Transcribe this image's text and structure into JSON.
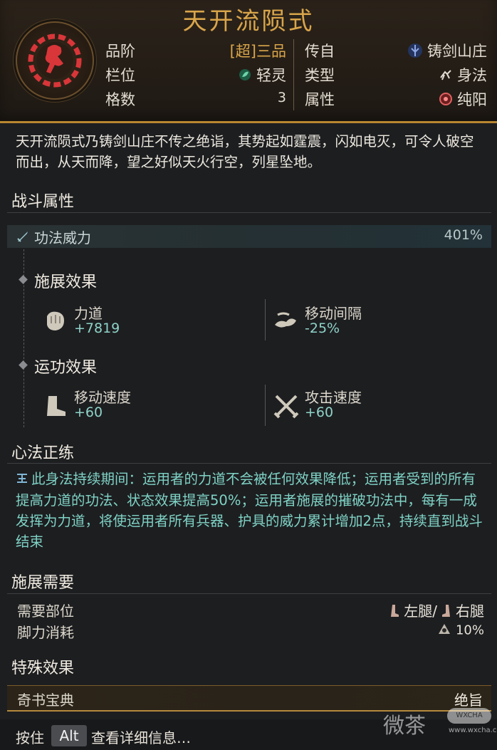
{
  "header": {
    "title": "天开流陨式",
    "rank_label": "品阶",
    "rank_value": "[超]三品",
    "slot_label": "栏位",
    "slot_value": "轻灵",
    "cells_label": "格数",
    "cells_value": "3",
    "origin_label": "传自",
    "origin_value": "铸剑山庄",
    "type_label": "类型",
    "type_value": "身法",
    "attr_label": "属性",
    "attr_value": "纯阳"
  },
  "description": "天开流陨式乃铸剑山庄不传之绝诣，其势起如霆震，闪如电灭，可令人破空而出，从天而降，望之好似天火行空，列星坠地。",
  "combat": {
    "section_title": "战斗属性",
    "power_label": "功法威力",
    "power_value": "401%",
    "cast_title": "施展效果",
    "cast_stats": [
      {
        "name": "力道",
        "value": "+7819",
        "icon": "fist-icon"
      },
      {
        "name": "移动间隔",
        "value": "-25%",
        "icon": "cloud-icon"
      }
    ],
    "run_title": "运功效果",
    "run_stats": [
      {
        "name": "移动速度",
        "value": "+60",
        "icon": "boot-icon"
      },
      {
        "name": "攻击速度",
        "value": "+60",
        "icon": "crossed-swords-icon"
      }
    ]
  },
  "mind": {
    "section_title": "心法正练",
    "text": "此身法持续期间：运用者的力道不会被任何效果降低；运用者受到的所有提高力道的功法、状态效果提高50%；运用者施展的摧破功法中，每有一成发挥为力道，将使运用者所有兵器、护具的威力累计增加2点，持续直到战斗结束"
  },
  "requirements": {
    "section_title": "施展需要",
    "part_label": "需要部位",
    "part_left": "左腿",
    "part_sep": "/",
    "part_right": "右腿",
    "stamina_label": "脚力消耗",
    "stamina_value": "10%"
  },
  "special": {
    "section_title": "特殊效果",
    "book_label": "奇书宝典",
    "book_value": "绝旨"
  },
  "footer": {
    "press": "按住",
    "key": "Alt",
    "hint": "查看详细信息…"
  },
  "watermark": {
    "text": "微茶",
    "badge": "WXCHA",
    "url": "www.wxcha.com"
  },
  "colors": {
    "accent_gold": "#d9a54a",
    "stat_teal": "#8fd3c9",
    "emblem_red": "#d9363a"
  }
}
